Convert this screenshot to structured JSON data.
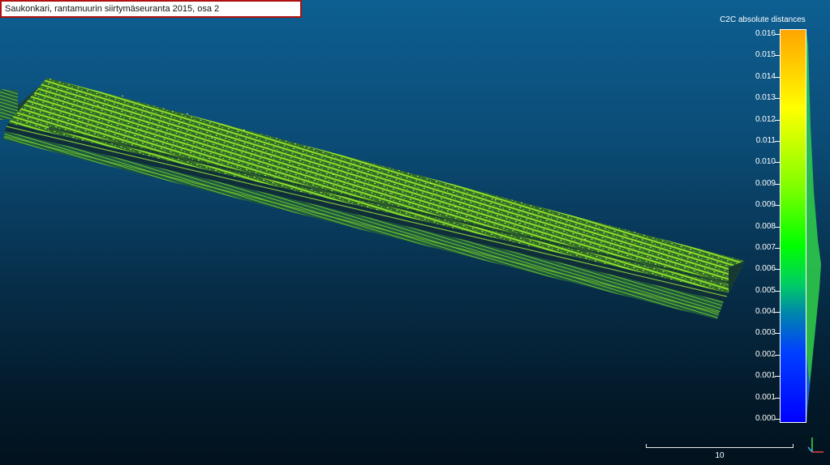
{
  "title": "Saukonkari, rantamuurin siirtymäseuranta 2015, osa 2",
  "scalar_field": {
    "title": "C2C absolute distances",
    "labels": [
      "0.016",
      "0.015",
      "0.014",
      "0.013",
      "0.012",
      "0.011",
      "0.010",
      "0.009",
      "0.009",
      "0.008",
      "0.007",
      "0.006",
      "0.005",
      "0.004",
      "0.003",
      "0.002",
      "0.001",
      "0.001",
      "0.000"
    ],
    "colors": {
      "high": "#ffa500",
      "mid": "#00ff00",
      "low": "#0000ff"
    }
  },
  "scale_bar": {
    "label": "10"
  },
  "icons": {
    "axes": "axis-trihedron-icon"
  },
  "colors": {
    "background_top": "#0d5f92",
    "background_bottom": "#02121d",
    "point_cloud": "#7fd420",
    "title_border": "#b01010"
  }
}
